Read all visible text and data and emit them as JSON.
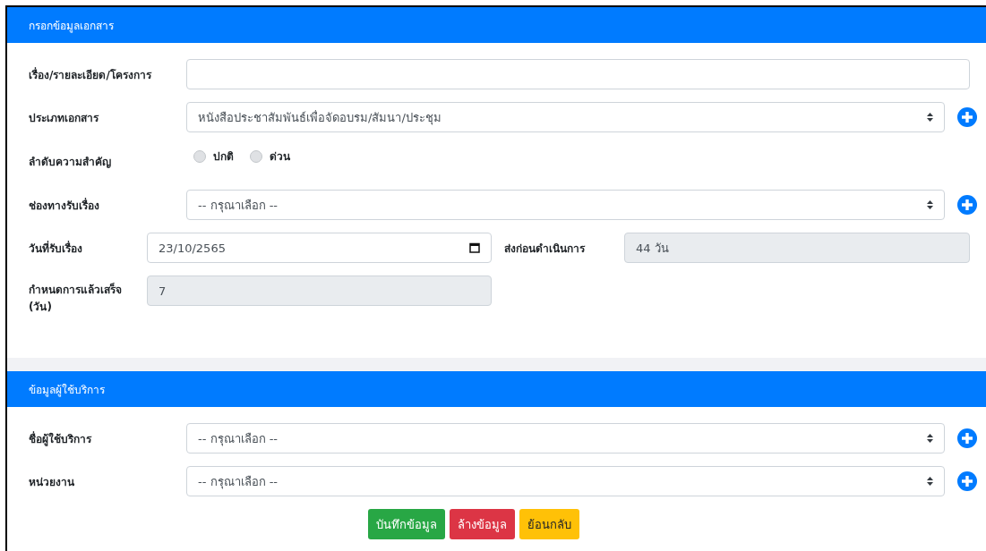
{
  "sections": [
    {
      "title": "กรอกข้อมูลเอกสาร",
      "rows": [
        {
          "kind": "text",
          "label": "เรื่อง/รายละเอียด/โครงการ"
        },
        {
          "kind": "select",
          "label": "ประเภทเอกสาร",
          "value": "หนังสือประชาสัมพันธ์เพื่อจัดอบรม/สัมนา/ประชุม"
        },
        {
          "kind": "radio",
          "label": "ลำดับความสำคัญ",
          "options": [
            {
              "label": "ปกติ",
              "selected": false
            },
            {
              "label": "ด่วน",
              "selected": false
            }
          ]
        },
        {
          "kind": "select",
          "label": "ช่องทางรับเรื่อง",
          "value": "-- กรุณาเลือก --"
        },
        {
          "kind": "pair",
          "fields": [
            {
              "kind": "date",
              "label": "วันที่รับเรื่อง",
              "value": "23/10/2565"
            },
            {
              "kind": "readonly",
              "label": "ส่งก่อนดำเนินการ",
              "value": "44 วัน"
            }
          ]
        },
        {
          "kind": "half",
          "fields": [
            {
              "kind": "readonly",
              "label": "กำหนดการแล้วเสร็จ (วัน)",
              "value": "7"
            }
          ]
        }
      ]
    },
    {
      "title": "ข้อมูลผู้ใช้บริการ",
      "rows": [
        {
          "kind": "select",
          "label": "ชื่อผู้ใช้บริการ",
          "value": "-- กรุณาเลือก --"
        },
        {
          "kind": "select",
          "label": "หน่วยงาน",
          "value": "-- กรุณาเลือก --"
        }
      ]
    }
  ],
  "buttons": [
    {
      "kind": "success",
      "label": "บันทึกข้อมูล"
    },
    {
      "kind": "danger",
      "label": "ล้างข้อมูล"
    },
    {
      "kind": "warning",
      "label": "ย้อนกลับ"
    }
  ]
}
